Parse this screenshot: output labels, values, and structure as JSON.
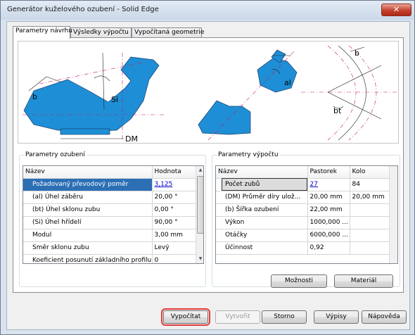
{
  "window": {
    "title": "Generátor kuželového ozubení - Solid Edge",
    "close_glyph": "✕"
  },
  "tabs": [
    {
      "label": "Parametry návrhu"
    },
    {
      "label": "Výsledky výpočtu"
    },
    {
      "label": "Vypočítaná geometrie"
    }
  ],
  "diagram": {
    "labels": [
      "b",
      "Si",
      "DM",
      "al",
      "bt",
      "b"
    ]
  },
  "gear_params": {
    "title": "Parametry ozubení",
    "headers": [
      "Název",
      "Hodnota"
    ],
    "rows": [
      {
        "name": "Požadovaný převodový poměr",
        "value": "3,125"
      },
      {
        "name": "(al) Úhel záběru",
        "value": "20,00 °"
      },
      {
        "name": "(bt) Úhel sklonu zubu",
        "value": "0,00 °"
      },
      {
        "name": "(Si) Úhel hřídelí",
        "value": "90,00 °"
      },
      {
        "name": "Modul",
        "value": "3,00 mm"
      },
      {
        "name": "Směr sklonu zubu",
        "value": "Levý"
      },
      {
        "name": "Koeficient posunutí základního profilu",
        "value": "0"
      }
    ]
  },
  "calc_params": {
    "title": "Parametry výpočtu",
    "headers": [
      "Název",
      "Pastorek",
      "Kolo"
    ],
    "rows": [
      {
        "name": "Počet zubů",
        "pinion": "27",
        "gear": "84"
      },
      {
        "name": "(DM) Průměr díry ulož...",
        "pinion": "20,00 mm",
        "gear": "20,00 mm"
      },
      {
        "name": "(b) Šířka ozubení",
        "pinion": "22,00 mm",
        "gear": ""
      },
      {
        "name": "Výkon",
        "pinion": "1000,000 ...",
        "gear": ""
      },
      {
        "name": "Otáčky",
        "pinion": "6000,000 ...",
        "gear": ""
      },
      {
        "name": "Účinnost",
        "pinion": "0,92",
        "gear": ""
      }
    ]
  },
  "buttons": {
    "options": "Možnosti",
    "material": "Materiál",
    "calculate": "Vypočítat",
    "create": "Vytvořit",
    "cancel": "Storno",
    "listings": "Výpisy",
    "help": "Nápověda"
  },
  "colors": {
    "gear_fill": "#1e8fd6",
    "selection": "#2c6fb5",
    "highlight": "#e23b3b"
  }
}
